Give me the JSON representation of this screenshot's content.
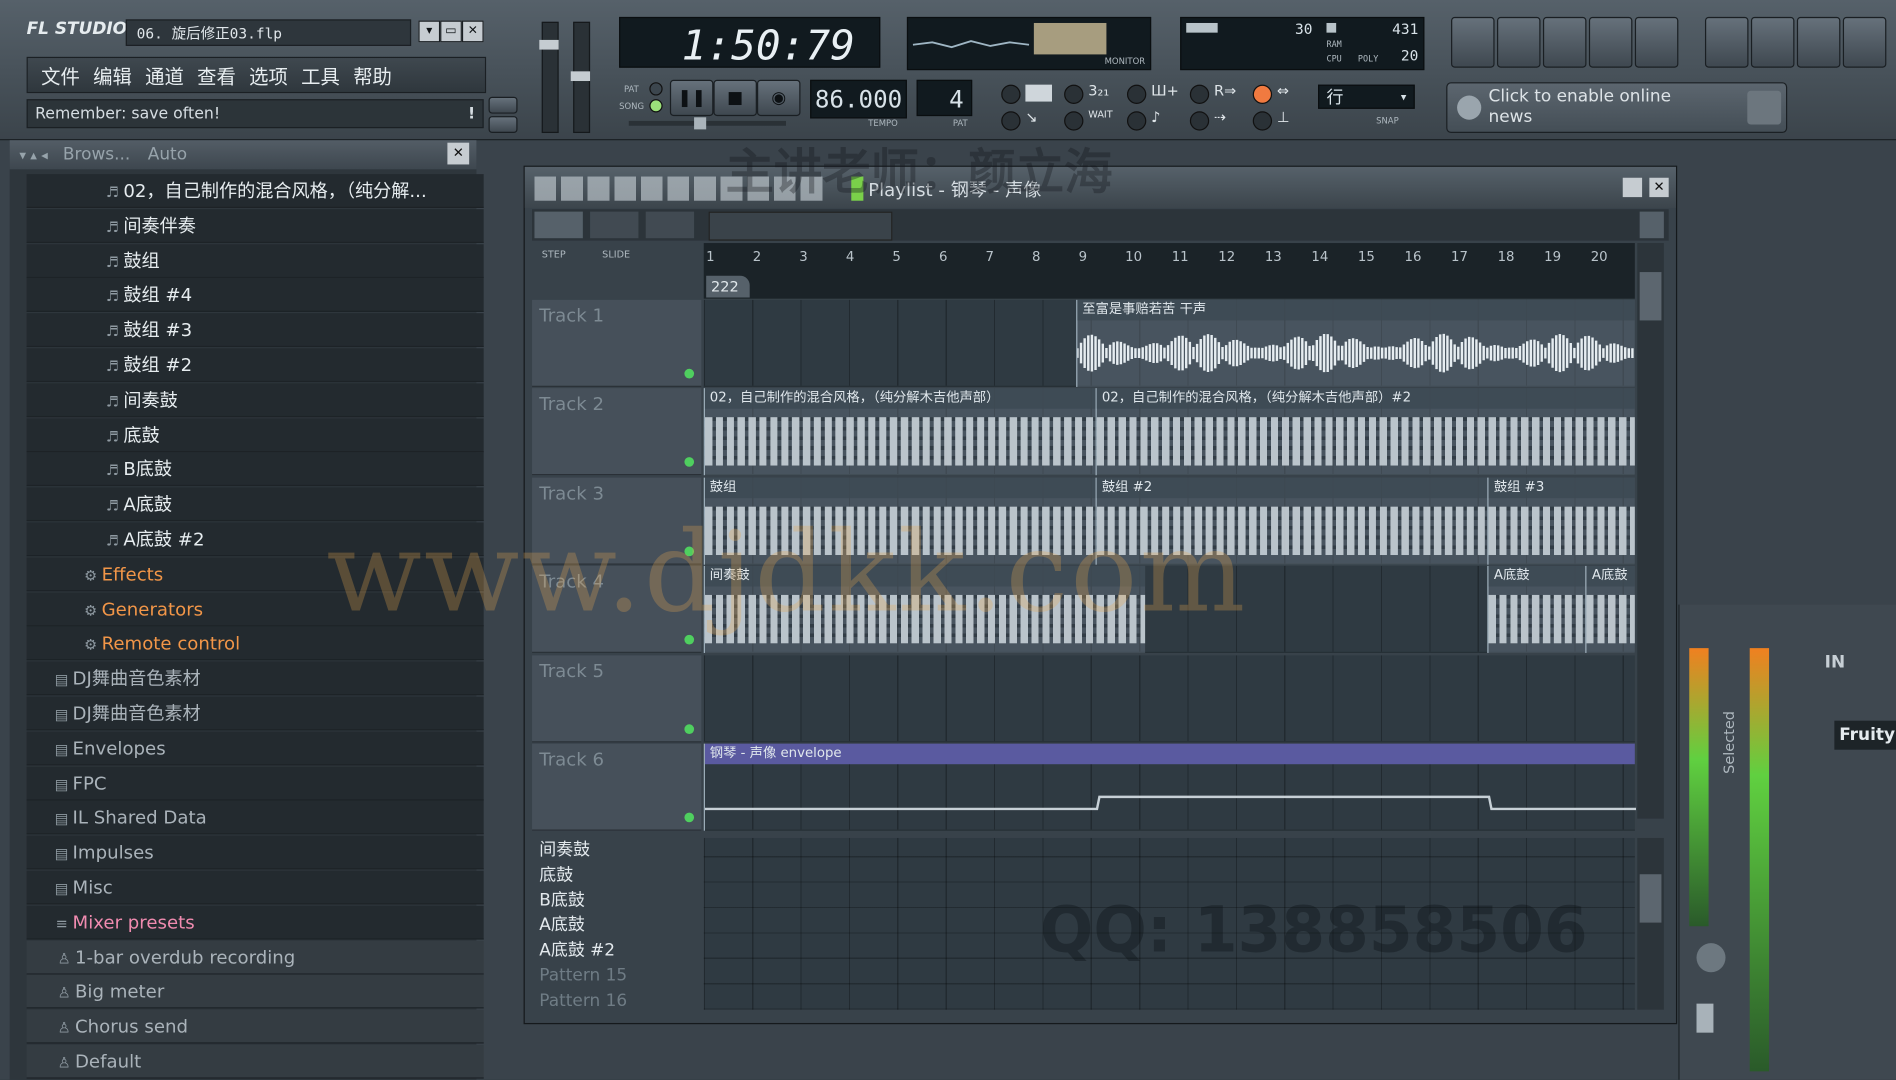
{
  "app": {
    "logo": "FL STUDIO",
    "file_name": "06. 旋后修正03.flp",
    "menu": [
      "文件",
      "编辑",
      "通道",
      "查看",
      "选项",
      "工具",
      "帮助"
    ],
    "hint": "Remember: save often!"
  },
  "transport": {
    "time": "1:50:79",
    "tempo": "86.000",
    "tempo_label": "TEMPO",
    "pattern": "4",
    "pattern_label": "PAT",
    "pat_label": "PAT",
    "song_label": "SONG",
    "monitor_label": "MONITOR",
    "cpu_value": "30",
    "ram_value": "431",
    "poly_value": "20",
    "ram_label": "RAM",
    "cpu_label": "CPU",
    "poly_label": "POLY",
    "snap_value": "行",
    "snap_label": "SNAP",
    "wait_label": "WAIT"
  },
  "news": {
    "text": "Click to enable online news"
  },
  "browser": {
    "header_title": "Brows...",
    "header_mode": "Auto",
    "items": [
      {
        "label": "02，自己制作的混合风格，（纯分解...",
        "style": "pattern"
      },
      {
        "label": "间奏伴奏",
        "style": "pattern"
      },
      {
        "label": "鼓组",
        "style": "pattern"
      },
      {
        "label": "鼓组 #4",
        "style": "pattern"
      },
      {
        "label": "鼓组 #3",
        "style": "pattern"
      },
      {
        "label": "鼓组 #2",
        "style": "pattern"
      },
      {
        "label": "间奏鼓",
        "style": "pattern"
      },
      {
        "label": "底鼓",
        "style": "pattern"
      },
      {
        "label": "B底鼓",
        "style": "pattern"
      },
      {
        "label": "A底鼓",
        "style": "pattern"
      },
      {
        "label": "A底鼓 #2",
        "style": "pattern"
      },
      {
        "label": "Effects",
        "style": "orange"
      },
      {
        "label": "Generators",
        "style": "orange"
      },
      {
        "label": "Remote control",
        "style": "orange"
      },
      {
        "label": "DJ舞曲音色素材",
        "style": "folder"
      },
      {
        "label": "DJ舞曲音色素材",
        "style": "folder"
      },
      {
        "label": "Envelopes",
        "style": "folder"
      },
      {
        "label": "FPC",
        "style": "folder"
      },
      {
        "label": "IL Shared Data",
        "style": "folder"
      },
      {
        "label": "Impulses",
        "style": "folder"
      },
      {
        "label": "Misc",
        "style": "folder"
      },
      {
        "label": "Mixer presets",
        "style": "pink"
      },
      {
        "label": "1-bar overdub recording",
        "style": "preset"
      },
      {
        "label": "Big meter",
        "style": "preset"
      },
      {
        "label": "Chorus send",
        "style": "preset"
      },
      {
        "label": "Default",
        "style": "preset"
      }
    ]
  },
  "playlist": {
    "title": "Playlist - 钢琴 - 声像",
    "step_label": "STEP",
    "slide_label": "SLIDE",
    "ruler": [
      "1",
      "2",
      "3",
      "4",
      "5",
      "6",
      "7",
      "8",
      "9",
      "10",
      "11",
      "12",
      "13",
      "14",
      "15",
      "16",
      "17",
      "18",
      "19",
      "20"
    ],
    "position_marker": "222",
    "tracks": [
      {
        "name": "Track 1",
        "clips": [
          {
            "label": "至富是事赔若苦 干声",
            "start": 8.6,
            "end": 20,
            "kind": "audio"
          }
        ]
      },
      {
        "name": "Track 2",
        "clips": [
          {
            "label": "02，自己制作的混合风格，（纯分解木吉他声部）",
            "start": 1,
            "end": 9,
            "kind": "notes"
          },
          {
            "label": "02，自己制作的混合风格，（纯分解木吉他声部）#2",
            "start": 9,
            "end": 20,
            "kind": "notes"
          }
        ]
      },
      {
        "name": "Track 3",
        "clips": [
          {
            "label": "鼓组",
            "start": 1,
            "end": 9,
            "kind": "notes"
          },
          {
            "label": "鼓组 #2",
            "start": 9,
            "end": 17,
            "kind": "notes"
          },
          {
            "label": "鼓组 #3",
            "start": 17,
            "end": 20,
            "kind": "notes"
          }
        ]
      },
      {
        "name": "Track 4",
        "clips": [
          {
            "label": "间奏鼓",
            "start": 1,
            "end": 10,
            "kind": "notes"
          },
          {
            "label": "A底鼓",
            "start": 17,
            "end": 19,
            "kind": "notes"
          },
          {
            "label": "A底鼓",
            "start": 19,
            "end": 20,
            "kind": "notes"
          }
        ]
      },
      {
        "name": "Track 5",
        "clips": []
      },
      {
        "name": "Track 6",
        "clips": [
          {
            "label": "钢琴 - 声像 envelope",
            "start": 1,
            "end": 20,
            "kind": "envelope"
          }
        ]
      }
    ],
    "patterns": [
      "间奏鼓",
      "底鼓",
      "B底鼓",
      "A底鼓",
      "A底鼓 #2",
      "Pattern 15",
      "Pattern 16"
    ]
  },
  "mixer": {
    "insert_label": "IN",
    "plugin": "Fruity",
    "selected_label": "Selected"
  },
  "watermarks": {
    "web": "www.djdkk.com",
    "qq": "QQ: 138858506",
    "teacher": "主讲老师：颜立海"
  }
}
